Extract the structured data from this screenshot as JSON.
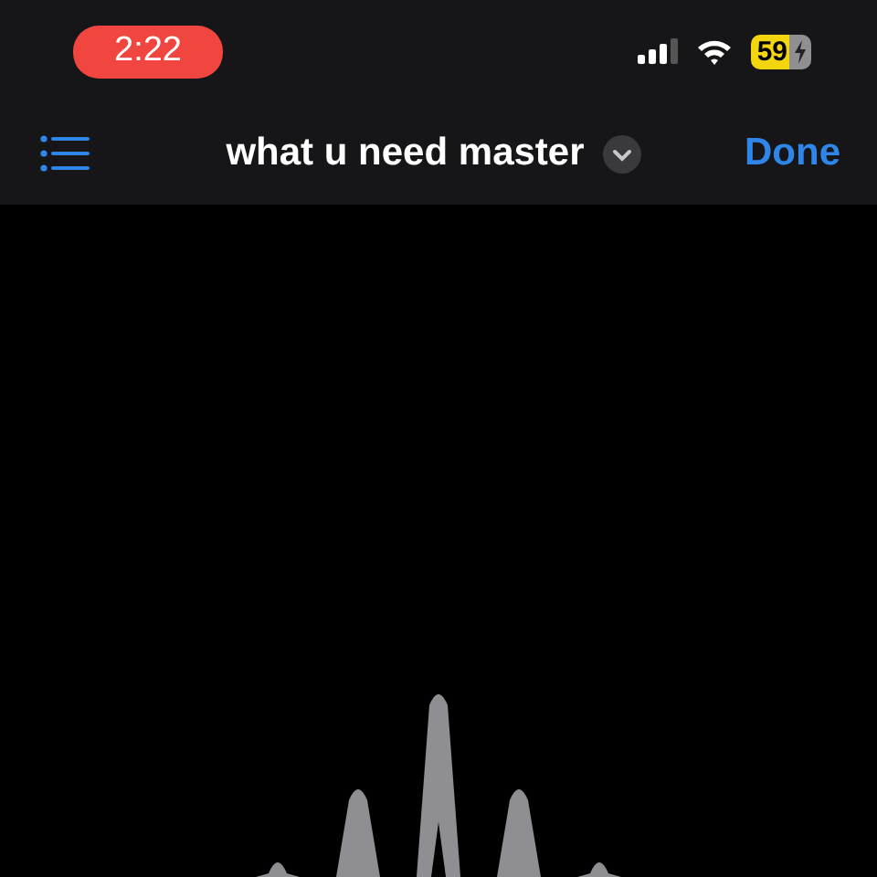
{
  "status_bar": {
    "time": "2:22",
    "battery": "59"
  },
  "nav_bar": {
    "title": "what u need master",
    "done": "Done"
  }
}
